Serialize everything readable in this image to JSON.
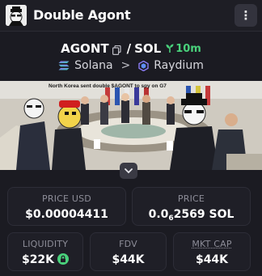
{
  "header": {
    "title": "Double Agont",
    "menu_glyph": "⋮"
  },
  "pair": {
    "base": "AGONT",
    "separator": "/",
    "quote": "SOL",
    "age": "10m"
  },
  "chain": {
    "network": "Solana",
    "arrow": ">",
    "dex": "Raydium"
  },
  "banner": {
    "caption": "North Korea sent double $AGONT to spy on G7"
  },
  "stats": {
    "price_usd_label": "PRICE USD",
    "price_usd_value": "$0.00004411",
    "price_label": "PRICE",
    "price_value_prefix": "0.0",
    "price_value_zeros": "6",
    "price_value_digits": "2569 SOL",
    "liquidity_label": "LIQUIDITY",
    "liquidity_value": "$22K",
    "fdv_label": "FDV",
    "fdv_value": "$44K",
    "mktcap_label": "MKT CAP",
    "mktcap_value": "$44K"
  },
  "colors": {
    "background": "#1b1b22",
    "card": "#1f1f27",
    "accent_green": "#49d17b",
    "label_gray": "#8d8d98"
  }
}
